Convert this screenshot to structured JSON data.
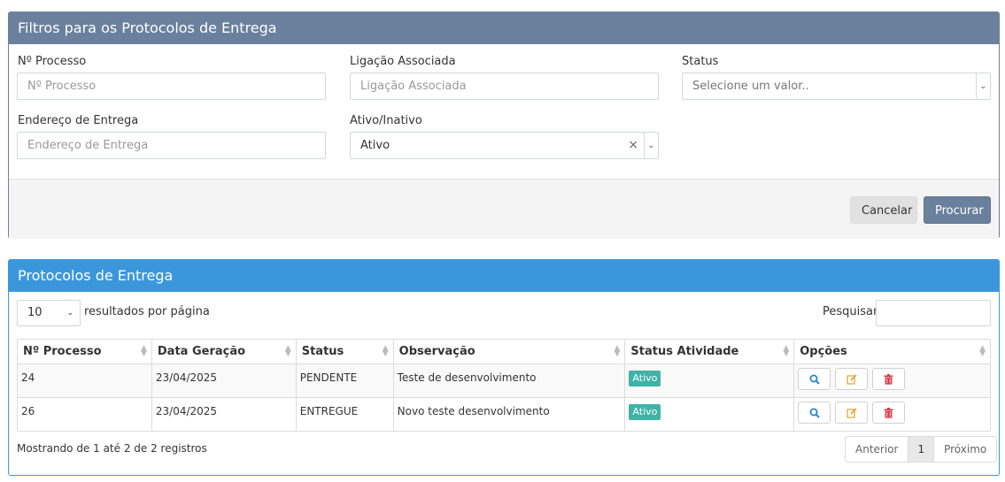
{
  "filters": {
    "title": "Filtros para os Protocolos de Entrega",
    "processo_label": "Nº Processo",
    "processo_placeholder": "Nº Processo",
    "ligacao_label": "Ligação Associada",
    "ligacao_placeholder": "Ligação Associada",
    "status_label": "Status",
    "status_placeholder": "Selecione um valor..",
    "endereco_label": "Endereço de Entrega",
    "endereco_placeholder": "Endereço de Entrega",
    "ativo_label": "Ativo/Inativo",
    "ativo_value": "Ativo",
    "cancel_label": "Cancelar",
    "search_label": "Procurar"
  },
  "list": {
    "title": "Protocolos de Entrega",
    "page_length": "10",
    "page_length_label": "resultados por página",
    "search_label": "Pesquisar",
    "columns": [
      "Nº Processo",
      "Data Geração",
      "Status",
      "Observação",
      "Status Atividade",
      "Opções"
    ],
    "rows": [
      {
        "processo": "24",
        "data": "23/04/2025",
        "status": "PENDENTE",
        "obs": "Teste de desenvolvimento",
        "atividade": "Ativo"
      },
      {
        "processo": "26",
        "data": "23/04/2025",
        "status": "ENTREGUE",
        "obs": "Novo teste desenvolvimento",
        "atividade": "Ativo"
      }
    ],
    "info": "Mostrando de 1 até 2 de 2 registros",
    "pager": {
      "prev": "Anterior",
      "current": "1",
      "next": "Próximo"
    }
  },
  "colors": {
    "filter_header": "#6a809d",
    "list_header": "#3b97dc",
    "badge": "#3fb3a5",
    "view_icon": "#2a86c8",
    "edit_icon": "#d9a531",
    "delete_icon": "#d43a4a"
  },
  "icons": [
    "search-icon",
    "edit-icon",
    "trash-icon",
    "sort-icon",
    "chevron-down-icon",
    "clear-icon"
  ]
}
